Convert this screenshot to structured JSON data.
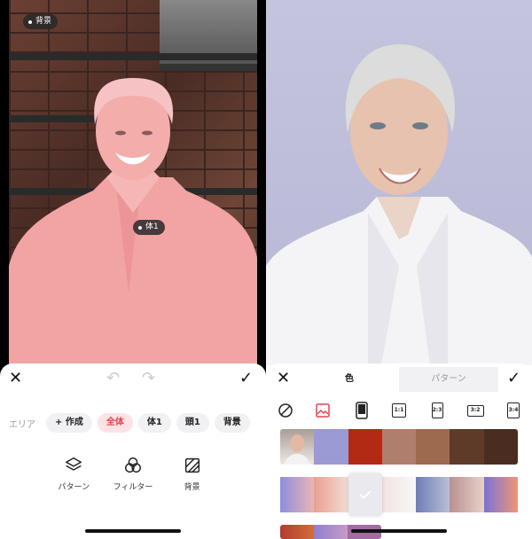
{
  "left": {
    "badge_bg": "背景",
    "badge_body": "体1",
    "area_label": "エリア",
    "chips": [
      {
        "label": "+ 作成",
        "active": false
      },
      {
        "label": "全体",
        "active": true
      },
      {
        "label": "体1",
        "active": false
      },
      {
        "label": "頭1",
        "active": false
      },
      {
        "label": "背景",
        "active": false
      }
    ],
    "tools": [
      {
        "label": "パターン",
        "icon": "layers-icon"
      },
      {
        "label": "フィルター",
        "icon": "filter-circles-icon"
      },
      {
        "label": "背景",
        "icon": "background-icon"
      }
    ]
  },
  "right": {
    "tabs": [
      "色",
      "パターン"
    ],
    "ratios": [
      "1:1",
      "2:3",
      "3:2",
      "3:4"
    ],
    "solid_colors": [
      "#9b9ad4",
      "#b22a14",
      "#b07e6d",
      "#9e6a4f",
      "#5e3b28",
      "#4a2d20"
    ],
    "gradient_row": [
      "linear-gradient(90deg,#8e8ee0,#eab4b4)",
      "linear-gradient(90deg,#e8a090,#f3dcd5)",
      "#e9e9ee",
      "linear-gradient(90deg,#f2e4e2,#f7f7f7)",
      "linear-gradient(90deg,#6e7db7,#b9bfd7)",
      "linear-gradient(90deg,#b99090,#e7d2c9)",
      "linear-gradient(90deg,#7b72d6,#f09675)"
    ],
    "bottom_row": [
      "linear-gradient(90deg,#b43a2e,#d36d3b)",
      "linear-gradient(90deg,#8f7fcf,#c79bc8)",
      "#a26ba1"
    ]
  },
  "colors": {
    "accent": "#ee3e52",
    "overlay_pink": "#f0a5a6"
  }
}
